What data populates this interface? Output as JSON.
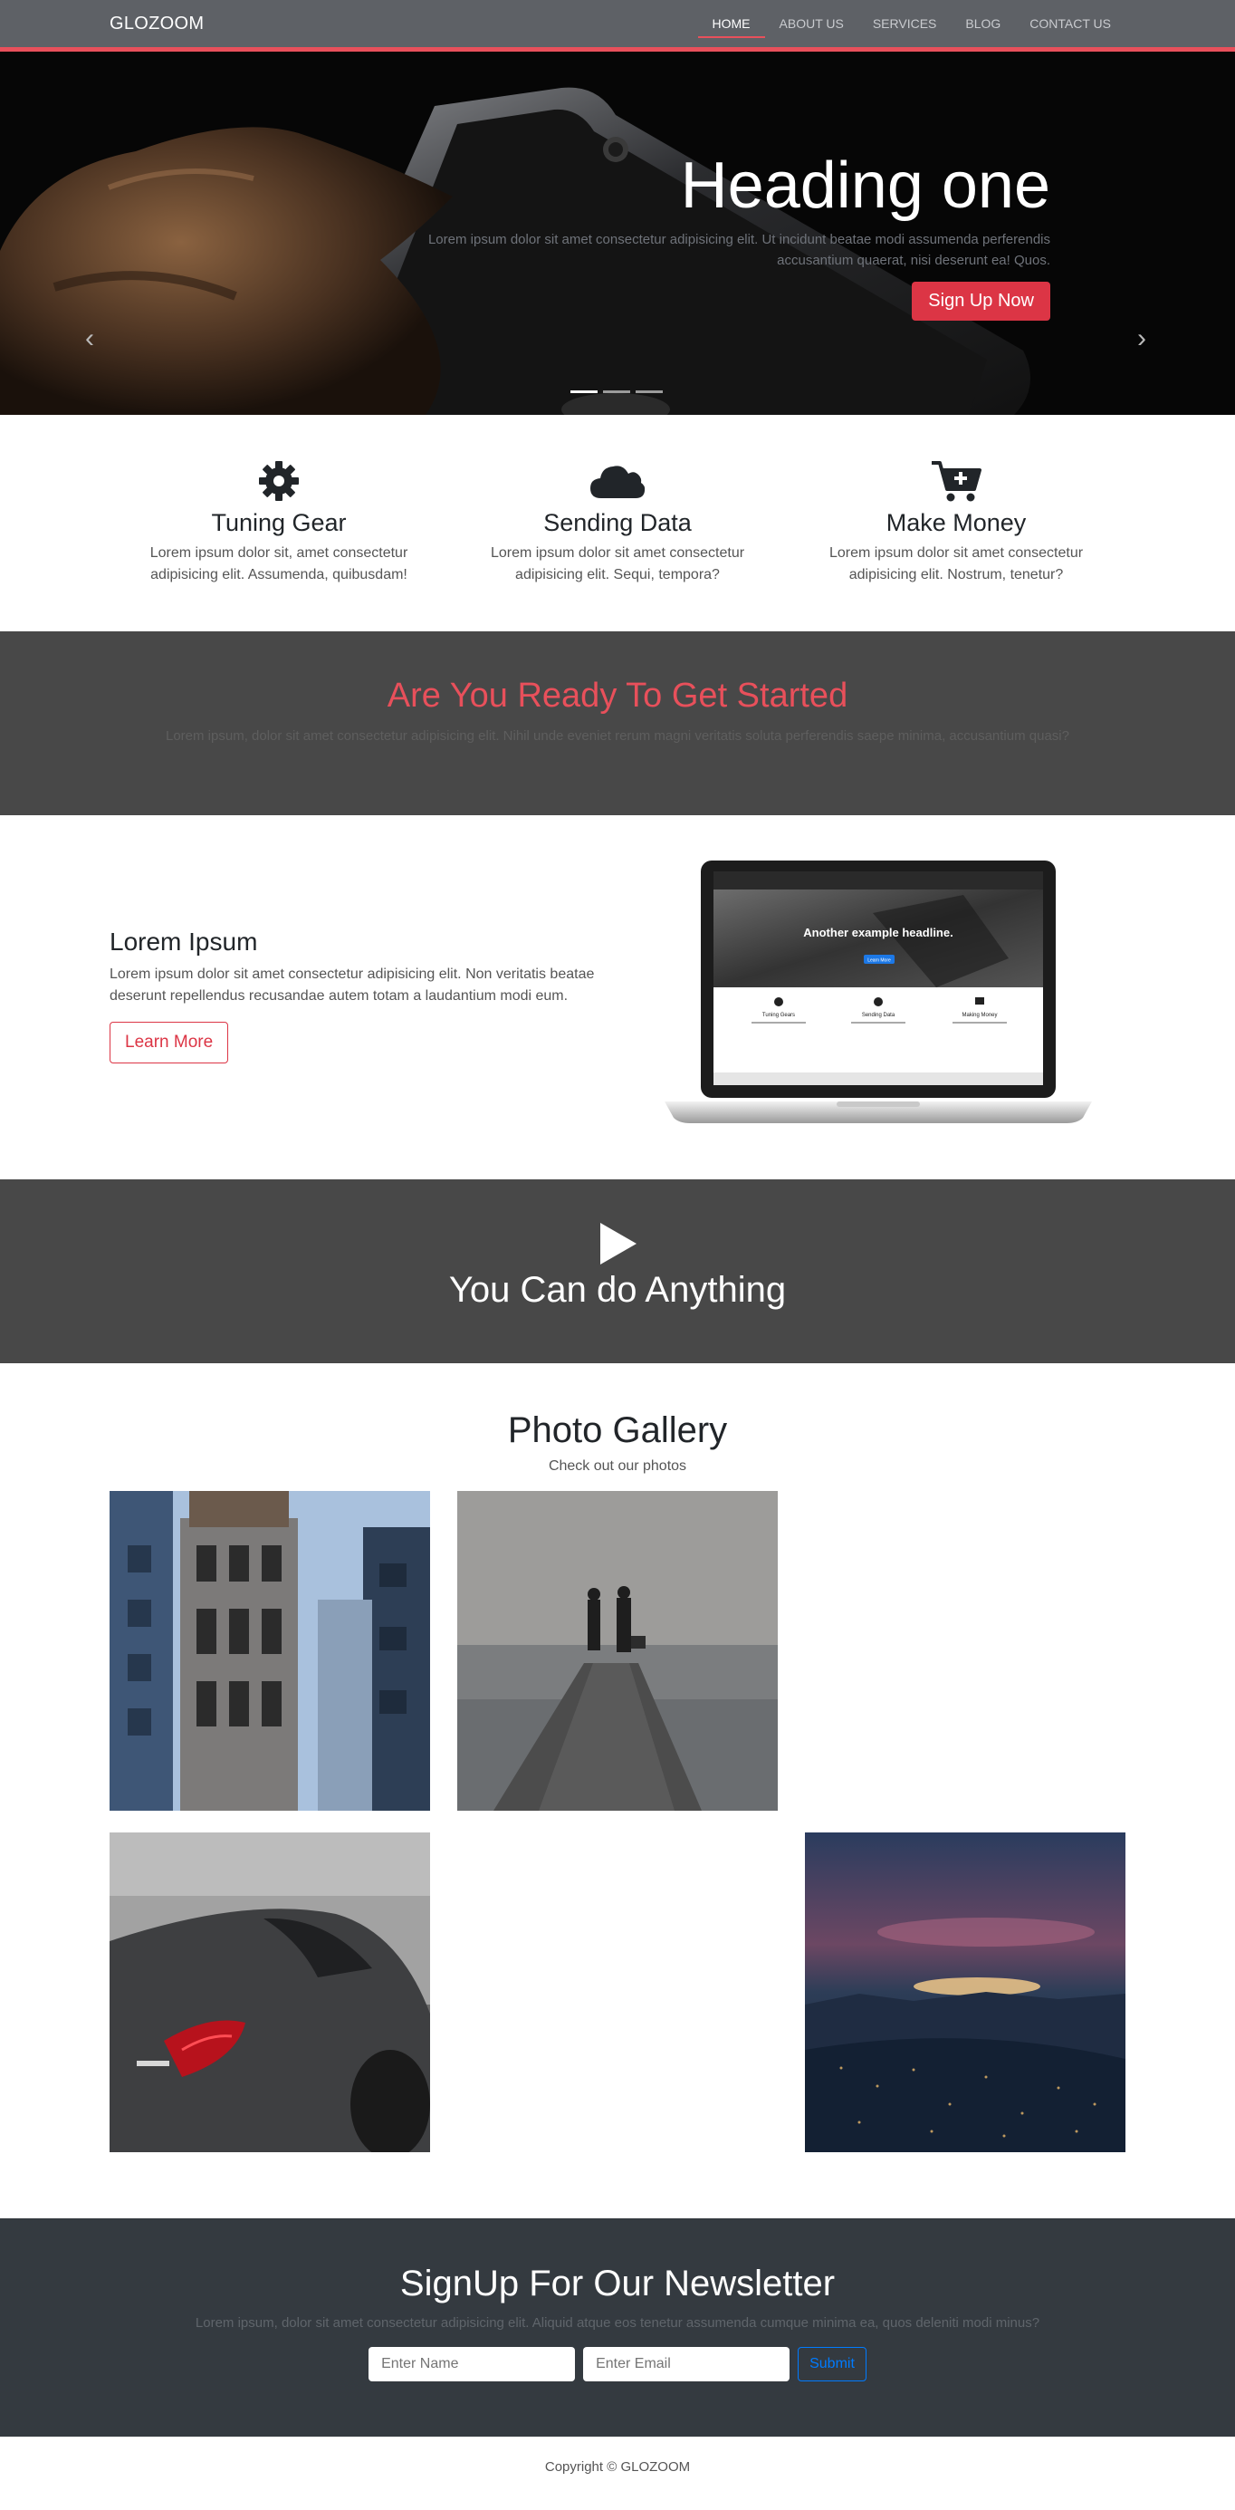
{
  "nav": {
    "brand": "GLOZOOM",
    "items": [
      {
        "label": "HOME"
      },
      {
        "label": "ABOUT US"
      },
      {
        "label": "SERVICES"
      },
      {
        "label": "BLOG"
      },
      {
        "label": "CONTACT US"
      }
    ]
  },
  "hero": {
    "heading": "Heading one",
    "text": "Lorem ipsum dolor sit amet consectetur adipisicing elit. Ut incidunt beatae modi assumenda perferendis accusantium quaerat, nisi deserunt ea! Quos.",
    "button": "Sign Up Now",
    "prev_icon": "chevron-left-icon",
    "next_icon": "chevron-right-icon",
    "active_slide": 1,
    "slides": 3
  },
  "features": [
    {
      "icon": "gear-icon",
      "title": "Tuning Gear",
      "text": "Lorem ipsum dolor sit, amet consectetur adipisicing elit. Assumenda, quibusdam!"
    },
    {
      "icon": "cloud-icon",
      "title": "Sending Data",
      "text": "Lorem ipsum dolor sit amet consectetur adipisicing elit. Sequi, tempora?"
    },
    {
      "icon": "cart-plus-icon",
      "title": "Make Money",
      "text": "Lorem ipsum dolor sit amet consectetur adipisicing elit. Nostrum, tenetur?"
    }
  ],
  "ready": {
    "heading": "Are You Ready To Get Started",
    "text": "Lorem ipsum, dolor sit amet consectetur adipisicing elit. Nihil unde eveniet rerum magni veritatis soluta perferendis saepe minima, accusantium quasi?"
  },
  "lorem": {
    "heading": "Lorem Ipsum",
    "text": "Lorem ipsum dolor sit amet consectetur adipisicing elit. Non veritatis beatae deserunt repellendus recusandae autem totam a laudantium modi eum.",
    "button": "Learn More",
    "screen": {
      "headline": "Another example headline.",
      "button": "Learn More",
      "features": [
        "Tuning Gears",
        "Sending Data",
        "Making Money"
      ]
    }
  },
  "video": {
    "icon": "play-icon",
    "heading": "You Can do Anything"
  },
  "gallery": {
    "heading": "Photo Gallery",
    "sub": "Check out our photos",
    "photos": [
      {
        "name": "photo-tower"
      },
      {
        "name": "photo-pier"
      },
      {
        "name": "photo-car"
      },
      {
        "name": "photo-city"
      }
    ]
  },
  "newsletter": {
    "heading": "SignUp For Our Newsletter",
    "text": "Lorem ipsum, dolor sit amet consectetur adipisicing elit. Aliquid atque eos tenetur assumenda cumque minima ea, quos deleniti modi minus?",
    "name_placeholder": "Enter Name",
    "email_placeholder": "Enter Email",
    "submit": "Submit"
  },
  "footer": {
    "copyright": "Copyright © GLOZOOM"
  },
  "colors": {
    "accent": "#e8505b",
    "danger": "#dc3545",
    "dark": "#343a40",
    "band": "#484848",
    "navbar": "#5e6166"
  }
}
